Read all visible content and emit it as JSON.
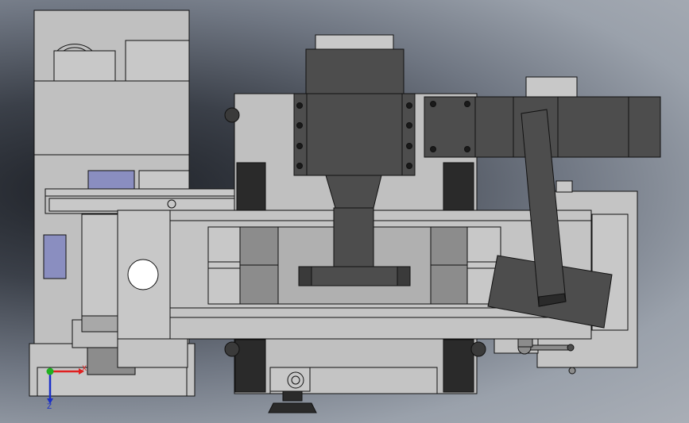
{
  "view": {
    "colors": {
      "part_fill": "#c0c0c0",
      "part_light": "#d0d0d0",
      "part_mid": "#8c8c8c",
      "part_dark": "#4d4d4d",
      "part_black": "#2a2a2a",
      "part_blue": "#8a8ec0",
      "outline": "#111111",
      "triad_x": "#e02020",
      "triad_y": "#20b020",
      "triad_z": "#1a2fc8"
    }
  },
  "triad": {
    "x_label": "X",
    "z_label": "Z"
  }
}
